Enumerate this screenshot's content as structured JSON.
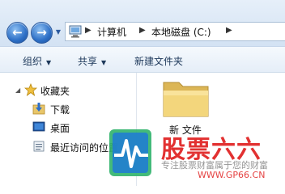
{
  "breadcrumb": {
    "items": [
      "计算机",
      "本地磁盘 (C:)"
    ]
  },
  "toolbar": {
    "organize_label": "组织",
    "share_label": "共享",
    "new_folder_label": "新建文件夹"
  },
  "nav_pane": {
    "favorites_label": "收藏夹",
    "items": [
      {
        "label": "下载",
        "icon": "download-folder-icon"
      },
      {
        "label": "桌面",
        "icon": "desktop-icon"
      },
      {
        "label": "最近访问的位置",
        "icon": "recent-places-icon"
      }
    ]
  },
  "content": {
    "folder_name": "新 文件"
  },
  "watermark": {
    "title": "股票六六",
    "slogan": "专注股票财富属于您的财富",
    "url": "WWW.GP66.CN"
  },
  "colors": {
    "address_gradient_top": "#e6eff9",
    "toolbar_text": "#1e395b",
    "watermark_red": "#e02020",
    "watermark_blue": "#1f7ad6",
    "watermark_green": "#2fb36b"
  }
}
